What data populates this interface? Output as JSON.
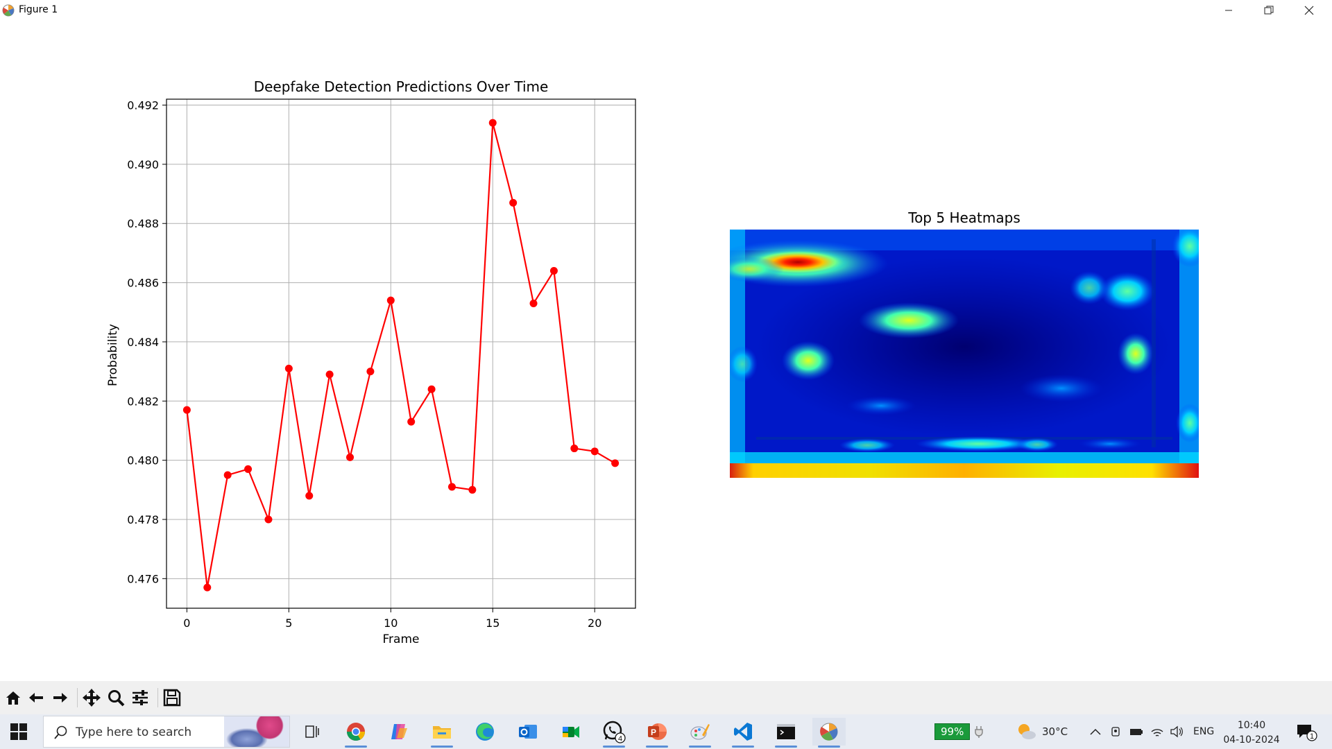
{
  "window": {
    "title": "Figure 1",
    "controls": [
      "minimize-icon",
      "restore-icon",
      "close-icon"
    ]
  },
  "line_chart": {
    "title": "Deepfake Detection Predictions Over Time",
    "xlabel": "Frame",
    "ylabel": "Probability",
    "xticks": [
      "0",
      "5",
      "10",
      "15",
      "20"
    ],
    "yticks": [
      "0.476",
      "0.478",
      "0.480",
      "0.482",
      "0.484",
      "0.486",
      "0.488",
      "0.490",
      "0.492"
    ]
  },
  "heatmap_panel": {
    "title": "Top 5 Heatmaps"
  },
  "chart_data": [
    {
      "type": "line",
      "title": "Deepfake Detection Predictions Over Time",
      "xlabel": "Frame",
      "ylabel": "Probability",
      "x": [
        0,
        1,
        2,
        3,
        4,
        5,
        6,
        7,
        8,
        9,
        10,
        11,
        12,
        13,
        14,
        15,
        16,
        17,
        18,
        19,
        20,
        21
      ],
      "series": [
        {
          "values": [
            0.4817,
            0.4757,
            0.4795,
            0.4797,
            0.478,
            0.4831,
            0.4788,
            0.4829,
            0.4801,
            0.483,
            0.4854,
            0.4813,
            0.4824,
            0.4791,
            0.479,
            0.4914,
            0.4887,
            0.4853,
            0.4864,
            0.4804,
            0.4803,
            0.4799
          ],
          "color": "#ff0000",
          "marker": "circle"
        }
      ],
      "xlim": [
        -1,
        22
      ],
      "ylim": [
        0.475,
        0.4922
      ],
      "grid": true
    },
    {
      "type": "heatmap",
      "title": "Top 5 Heatmaps",
      "colormap": "jet",
      "axes": "off"
    }
  ],
  "toolbar": {
    "buttons": [
      "home-icon",
      "back-icon",
      "forward-icon",
      "pan-icon",
      "zoom-icon",
      "configure-subplots-icon",
      "save-icon"
    ]
  },
  "taskbar": {
    "search_placeholder": "Type here to search",
    "apps": [
      "task-view-icon",
      "chrome-icon",
      "copilot-icon",
      "file-explorer-icon",
      "edge-icon",
      "outlook-icon",
      "meet-icon",
      "whatsapp-icon",
      "powerpoint-icon",
      "paint-icon",
      "vscode-icon",
      "terminal-icon",
      "matplotlib-icon"
    ],
    "whatsapp_badge": "4",
    "battery": "99%",
    "weather": "30°C",
    "language": "ENG",
    "time": "10:40",
    "date": "04-10-2024",
    "notifications": "1"
  }
}
